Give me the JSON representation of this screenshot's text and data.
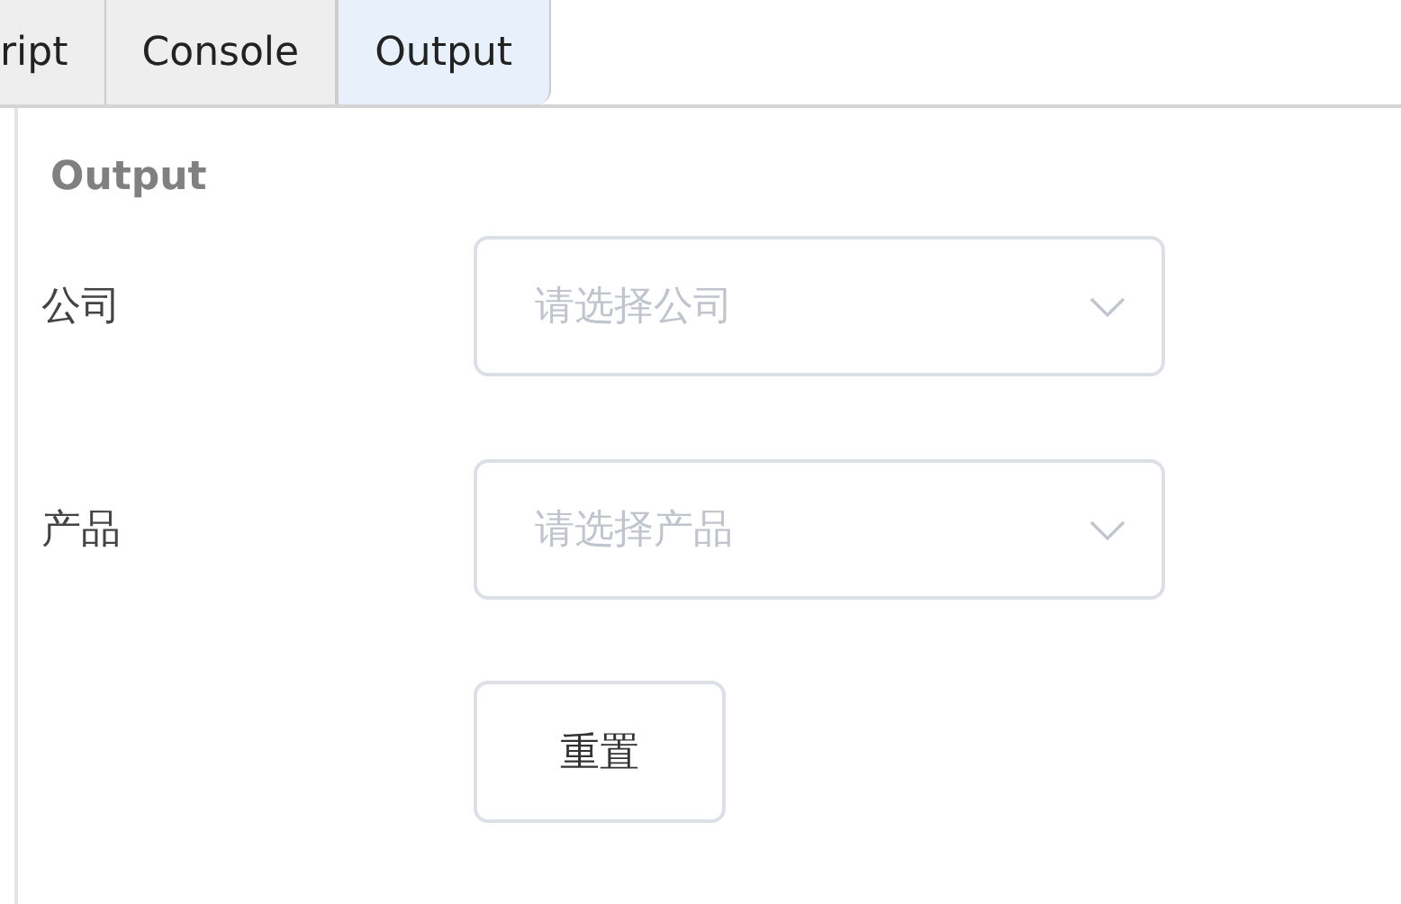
{
  "tabs": [
    {
      "label": "ript",
      "selected": false
    },
    {
      "label": "Console",
      "selected": false
    },
    {
      "label": "Output",
      "selected": true
    }
  ],
  "panel": {
    "title": "Output"
  },
  "form": {
    "fields": [
      {
        "label": "公司",
        "placeholder": "请选择公司"
      },
      {
        "label": "产品",
        "placeholder": "请选择产品"
      }
    ],
    "reset_button": "重置"
  }
}
